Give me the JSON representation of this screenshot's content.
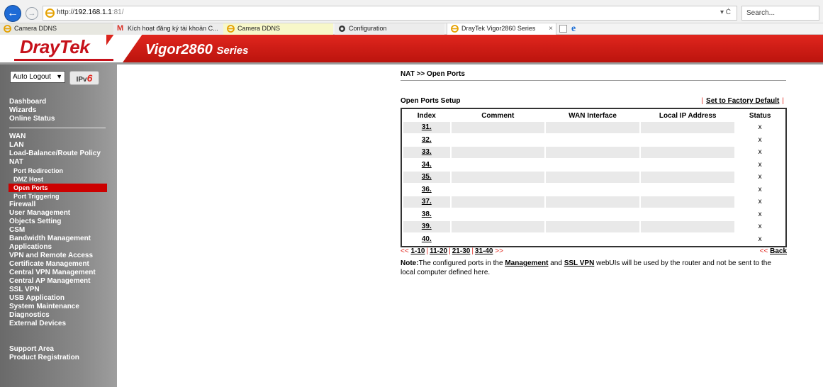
{
  "browser": {
    "url_prefix": "http://",
    "url_host": "192.168.1.1",
    "url_port": ":81/",
    "search_placeholder": "Search...",
    "refresh_label": "▾ Ċ",
    "tabs": [
      {
        "label": "Camera DDNS"
      },
      {
        "label": "Kích hoạt đăng ký tài khoản C..."
      },
      {
        "label": "Camera DDNS"
      },
      {
        "label": "Configuration"
      },
      {
        "label": "DrayTek Vigor2860 Series"
      }
    ]
  },
  "header": {
    "logo": "DrayTek",
    "model": "Vigor2860",
    "series": "Series"
  },
  "sidebar": {
    "auto_logout": "Auto Logout",
    "ipv6_label": "IPv",
    "ipv6_six": "6",
    "group1": [
      "Dashboard",
      "Wizards",
      "Online Status"
    ],
    "group2_top": [
      "WAN",
      "LAN",
      "Load-Balance/Route Policy",
      "NAT"
    ],
    "nat_sub": [
      "Port Redirection",
      "DMZ Host",
      "Open Ports",
      "Port Triggering"
    ],
    "group2_bottom": [
      "Firewall",
      "User Management",
      "Objects Setting",
      "CSM",
      "Bandwidth Management",
      "Applications",
      "VPN and Remote Access",
      "Certificate Management",
      "Central VPN Management",
      "Central AP Management",
      "SSL VPN",
      "USB Application",
      "System Maintenance",
      "Diagnostics",
      "External Devices"
    ],
    "group3": [
      "Support Area",
      "Product Registration"
    ]
  },
  "main": {
    "breadcrumb": "NAT >> Open Ports",
    "setup_title": "Open Ports Setup",
    "factory_default": "Set to Factory Default",
    "columns": [
      "Index",
      "Comment",
      "WAN Interface",
      "Local IP Address",
      "Status"
    ],
    "rows": [
      {
        "index": "31.",
        "comment": "",
        "wan": "",
        "local_ip": "",
        "status": "x"
      },
      {
        "index": "32.",
        "comment": "",
        "wan": "",
        "local_ip": "",
        "status": "x"
      },
      {
        "index": "33.",
        "comment": "",
        "wan": "",
        "local_ip": "",
        "status": "x"
      },
      {
        "index": "34.",
        "comment": "",
        "wan": "",
        "local_ip": "",
        "status": "x"
      },
      {
        "index": "35.",
        "comment": "",
        "wan": "",
        "local_ip": "",
        "status": "x"
      },
      {
        "index": "36.",
        "comment": "",
        "wan": "",
        "local_ip": "",
        "status": "x"
      },
      {
        "index": "37.",
        "comment": "",
        "wan": "",
        "local_ip": "",
        "status": "x"
      },
      {
        "index": "38.",
        "comment": "",
        "wan": "",
        "local_ip": "",
        "status": "x"
      },
      {
        "index": "39.",
        "comment": "",
        "wan": "",
        "local_ip": "",
        "status": "x"
      },
      {
        "index": "40.",
        "comment": "",
        "wan": "",
        "local_ip": "",
        "status": "x"
      }
    ],
    "pager": {
      "prev": "<<",
      "pages": [
        "1-10",
        "11-20",
        "21-30",
        "31-40"
      ],
      "next": ">>",
      "back_arrow": "<<",
      "back": "Back"
    },
    "note": {
      "label": "Note:",
      "text1": "The configured ports in the ",
      "link1": "Management",
      "text2": " and ",
      "link2": "SSL VPN",
      "text3": " webUIs will be used by the router and not be sent to the local computer defined here."
    }
  }
}
